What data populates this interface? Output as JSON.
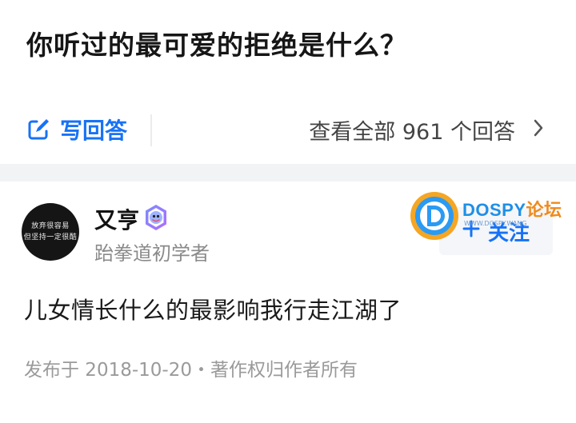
{
  "question": {
    "title": "你听过的最可爱的拒绝是什么？",
    "write_answer_label": "写回答",
    "view_all_label": "查看全部 961 个回答"
  },
  "answer": {
    "author": {
      "name": "又亨",
      "bio": "跆拳道初学者",
      "avatar_text_line1": "放弃很容易",
      "avatar_text_line2": "但坚持一定很酷"
    },
    "follow_label": "关注",
    "content": "儿女情长什么的最影响我行走江湖了",
    "meta": "发布于 2018-10-20・著作权归作者所有"
  },
  "watermark": {
    "brand_en": "DOSPY",
    "brand_cn": "论坛",
    "sub": "WWW.DOSPY.WANG"
  },
  "colors": {
    "accent": "#1772f6",
    "text_primary": "#1a1a1a",
    "text_secondary": "#8a8a8a",
    "band": "#f2f3f5"
  },
  "icons": {
    "write": "pencil-square-icon",
    "chevron": "chevron-right-icon",
    "plus": "plus-icon",
    "badge": "badge-icon"
  }
}
